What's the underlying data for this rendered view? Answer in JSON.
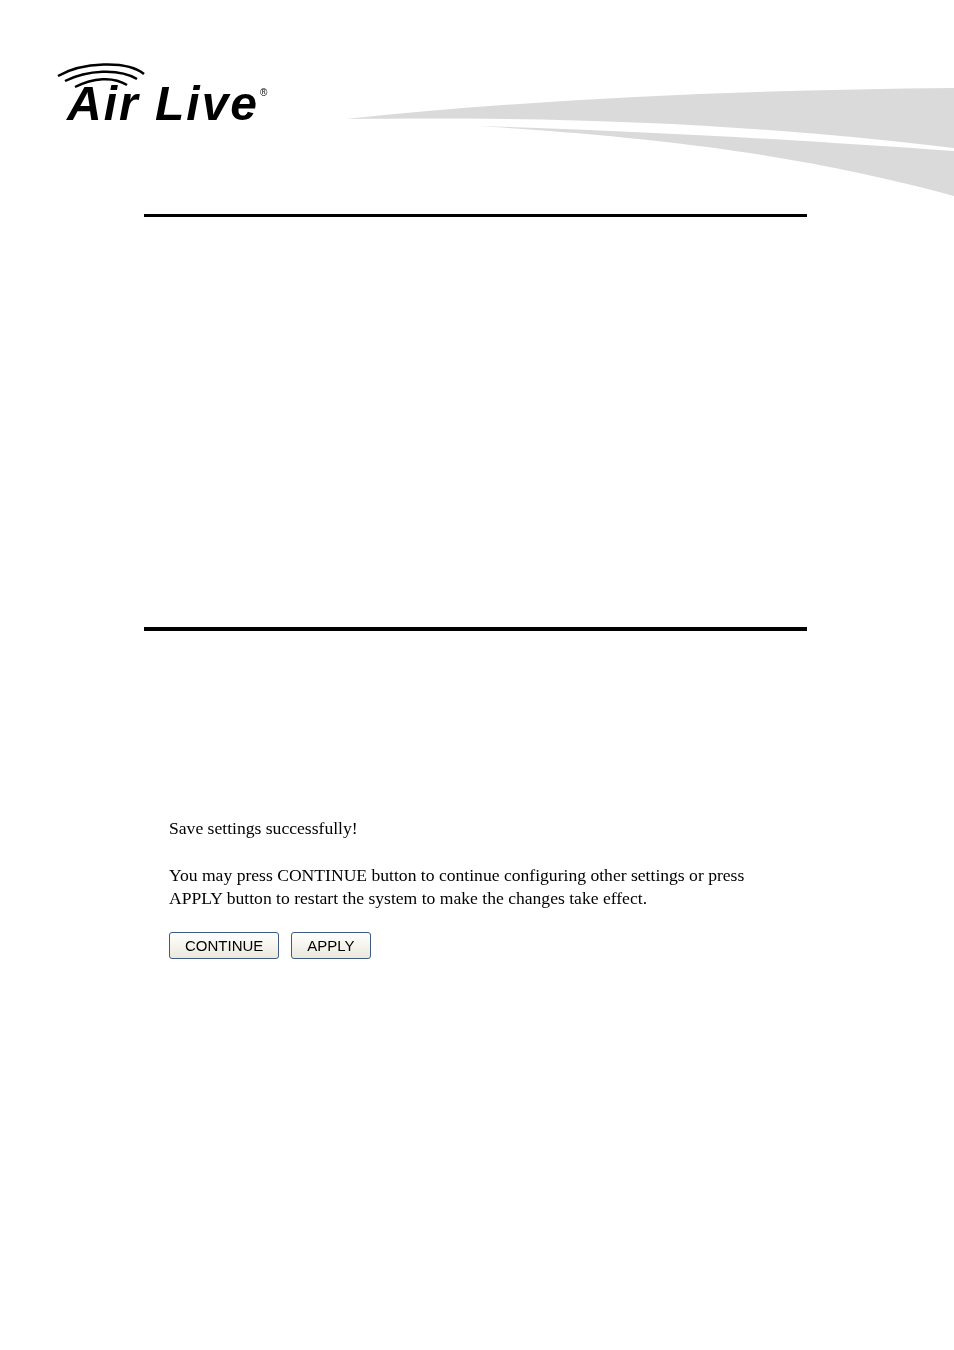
{
  "logo": {
    "name": "Air Live",
    "mark": "®"
  },
  "message": {
    "title": "Save settings successfully!",
    "body": "You may press CONTINUE button to continue configuring other settings or press APPLY button to restart the system to make the changes take effect."
  },
  "buttons": [
    {
      "label": "CONTINUE"
    },
    {
      "label": "APPLY"
    }
  ]
}
